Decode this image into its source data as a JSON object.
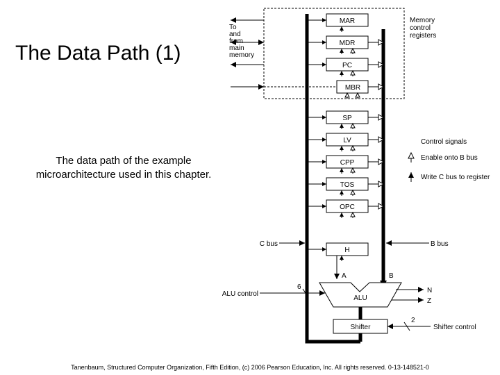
{
  "title": "The Data Path (1)",
  "caption": "The data path of the example microarchitecture used in this chapter.",
  "footer": "Tanenbaum, Structured Computer Organization, Fifth Edition, (c) 2006 Pearson Education, Inc. All rights reserved. 0-13-148521-0",
  "registers": [
    "MAR",
    "MDR",
    "PC",
    "MBR",
    "SP",
    "LV",
    "CPP",
    "TOS",
    "OPC",
    "H"
  ],
  "labels": {
    "mem_group": "Memory control registers",
    "mem_side": "To and from main memory",
    "control_signals": "Control signals",
    "enable_b": "Enable onto B bus",
    "write_c": "Write C bus to register",
    "c_bus": "C bus",
    "b_bus": "B bus",
    "alu_ctrl": "ALU control",
    "alu": "ALU",
    "shifter": "Shifter",
    "shifter_ctrl": "Shifter control",
    "A": "A",
    "B": "B",
    "N": "N",
    "Z": "Z",
    "six": "6",
    "two": "2"
  }
}
